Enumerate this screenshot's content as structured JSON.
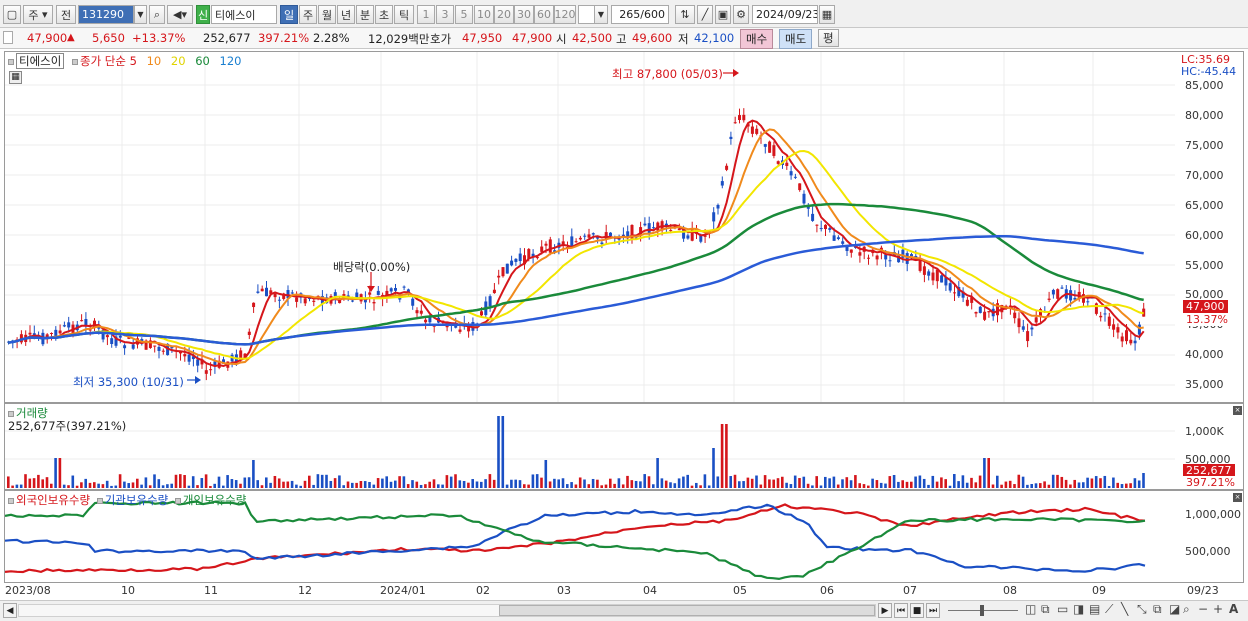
{
  "toolbar": {
    "market": "주",
    "prev_label": "전",
    "code": "131290",
    "name_prefix": "신",
    "name": "티에스이",
    "periods": [
      "일",
      "주",
      "월",
      "년",
      "분",
      "초",
      "틱"
    ],
    "active_period": "일",
    "multipliers": [
      "1",
      "3",
      "5",
      "10",
      "20",
      "30",
      "60",
      "120"
    ],
    "count": "265",
    "count_total": "/600",
    "date": "2024/09/23"
  },
  "quote": {
    "price": "47,900",
    "change": "5,650",
    "change_pct": "+13.37%",
    "volume": "252,677",
    "volume_ratio": "397.21%",
    "turnover": "2.28%",
    "amount": "12,029백만",
    "ask_label": "호가",
    "ask1": "47,950",
    "ask2": "47,900",
    "open_label": "시",
    "open": "42,500",
    "high_label": "고",
    "high": "49,600",
    "low_label": "저",
    "low": "42,100",
    "buy_label": "매수",
    "sell_label": "매도",
    "eval_label": "평"
  },
  "price_panel": {
    "stock_label": "티에스이",
    "ma_label": "종가 단순",
    "ma_periods": [
      "5",
      "10",
      "20",
      "60",
      "120"
    ],
    "ma_colors": [
      "#d5161b",
      "#f08a1c",
      "#f2e600",
      "#1a8a3a",
      "#2a5bd7"
    ],
    "lc": "LC:35.69",
    "hc": "HC:-45.44",
    "high_note": "최고 87,800 (05/03)",
    "low_note": "최저 35,300 (10/31)",
    "dividend_note": "배당락(0.00%)",
    "yticks": [
      "85,000",
      "80,000",
      "75,000",
      "70,000",
      "65,000",
      "60,000",
      "55,000",
      "50,000",
      "45,000",
      "40,000",
      "35,000"
    ],
    "current_box": "47,900",
    "current_pct_box": "13.37%"
  },
  "volume_panel": {
    "title": "거래량",
    "value": "252,677주(397.21%)",
    "yticks": [
      "1,000K",
      "500,000"
    ],
    "box1": "252,677",
    "box2": "397.21%"
  },
  "holding_panel": {
    "labels": [
      "외국인보유수량",
      "기관보유수량",
      "개인보유수량"
    ],
    "label_colors": [
      "#d5161b",
      "#1a4fc4",
      "#1a8a3a"
    ],
    "yticks": [
      "1,000,000",
      "500,000"
    ]
  },
  "x_axis": [
    "2023/08",
    "10",
    "11",
    "12",
    "2024/01",
    "02",
    "03",
    "04",
    "05",
    "06",
    "07",
    "08",
    "09",
    "09/23"
  ]
}
